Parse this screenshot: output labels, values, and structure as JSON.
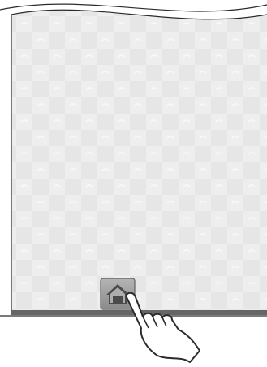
{
  "screen": {
    "background_color": "#e6e6e6",
    "pattern_color": "#f2f2f2",
    "frame_color": "#2b2b2b",
    "bottom_bar_color": "#666666"
  },
  "home_button": {
    "icon": "home-icon",
    "button_color": "#9a9a9a",
    "icon_color": "#4a4a4a"
  },
  "gesture": {
    "icon": "pointing-hand-icon",
    "action": "tap"
  }
}
